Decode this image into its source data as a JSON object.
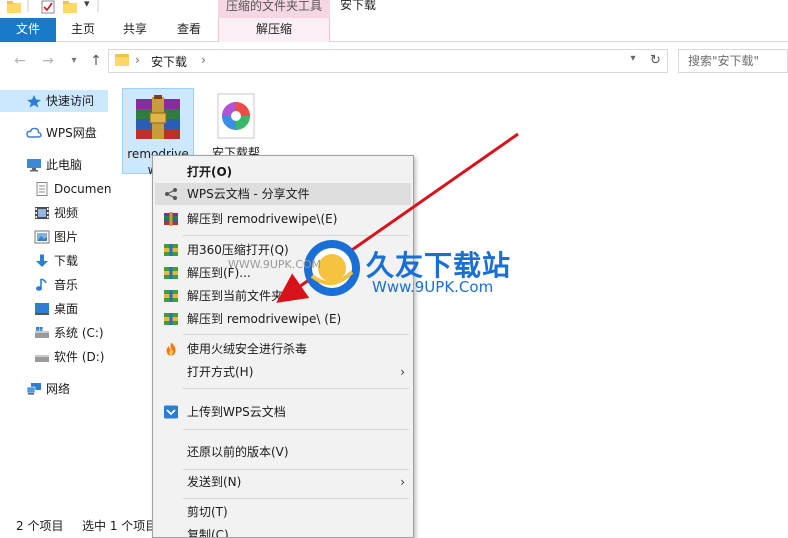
{
  "titlebar": {
    "context_tab_label": "压缩的文件夹工具",
    "window_title": "安下载"
  },
  "ribbon": {
    "tabs": [
      {
        "label": "文件",
        "left": 0
      },
      {
        "label": "主页"
      },
      {
        "label": "共享"
      },
      {
        "label": "查看"
      },
      {
        "label": "解压缩"
      }
    ]
  },
  "address": {
    "path_segment": "安下载",
    "search_placeholder": "搜索\"安下载\""
  },
  "navpane": {
    "items": [
      {
        "label": "快速访问",
        "icon": "star-icon"
      },
      {
        "label": "WPS网盘",
        "icon": "cloud-icon"
      },
      {
        "label": "此电脑",
        "icon": "computer-icon"
      },
      {
        "label": "Documen",
        "icon": "documents-icon"
      },
      {
        "label": "视频",
        "icon": "video-icon"
      },
      {
        "label": "图片",
        "icon": "pictures-icon"
      },
      {
        "label": "下载",
        "icon": "download-icon"
      },
      {
        "label": "音乐",
        "icon": "music-icon"
      },
      {
        "label": "桌面",
        "icon": "desktop-icon"
      },
      {
        "label": "系统 (C:)",
        "icon": "drive-c-icon"
      },
      {
        "label": "软件 (D:)",
        "icon": "drive-d-icon"
      },
      {
        "label": "网络",
        "icon": "network-icon"
      }
    ]
  },
  "files": [
    {
      "name_line1": "remodrive",
      "name_line2": "wip",
      "icon": "winrar-archive-icon"
    },
    {
      "name_line1": "安下载帮",
      "icon": "colorful-app-icon"
    }
  ],
  "status": {
    "item_count": "2 个项目",
    "selected": "选中 1 个项目"
  },
  "context_menu": {
    "items": [
      {
        "label": "打开(O)",
        "bold": true
      },
      {
        "label": "WPS云文档 - 分享文件",
        "icon": "share-icon",
        "highlight": true
      },
      {
        "label": "解压到 remodrivewipe\\(E)",
        "icon": "winrar-icon"
      },
      {
        "label": "用360压缩打开(Q)",
        "icon": "archive-360-icon"
      },
      {
        "label": "解压到(F)...",
        "icon": "archive-360-icon"
      },
      {
        "label": "解压到当前文件夹",
        "icon": "archive-360-icon"
      },
      {
        "label": "解压到 remodrivewipe\\ (E)",
        "icon": "archive-360-icon"
      },
      {
        "label": "使用火绒安全进行杀毒",
        "icon": "huorong-icon"
      },
      {
        "label": "打开方式(H)",
        "arrow": true
      },
      {
        "label": "上传到WPS云文档",
        "icon": "wps-cloud-icon"
      },
      {
        "label": "还原以前的版本(V)"
      },
      {
        "label": "发送到(N)",
        "arrow": true
      },
      {
        "label": "剪切(T)"
      },
      {
        "label": "复制(C)"
      }
    ]
  },
  "watermark": {
    "brand": "久友下载站",
    "url_small": "WWW.9UPK.COM",
    "url_large": "Www.9UPK.Com"
  },
  "colors": {
    "file_tab": "#1979ca",
    "context_tab": "#f5d6e3",
    "selection": "#cce8ff",
    "arrow_red": "#d8121b",
    "watermark_blue": "#1a6fd6"
  }
}
